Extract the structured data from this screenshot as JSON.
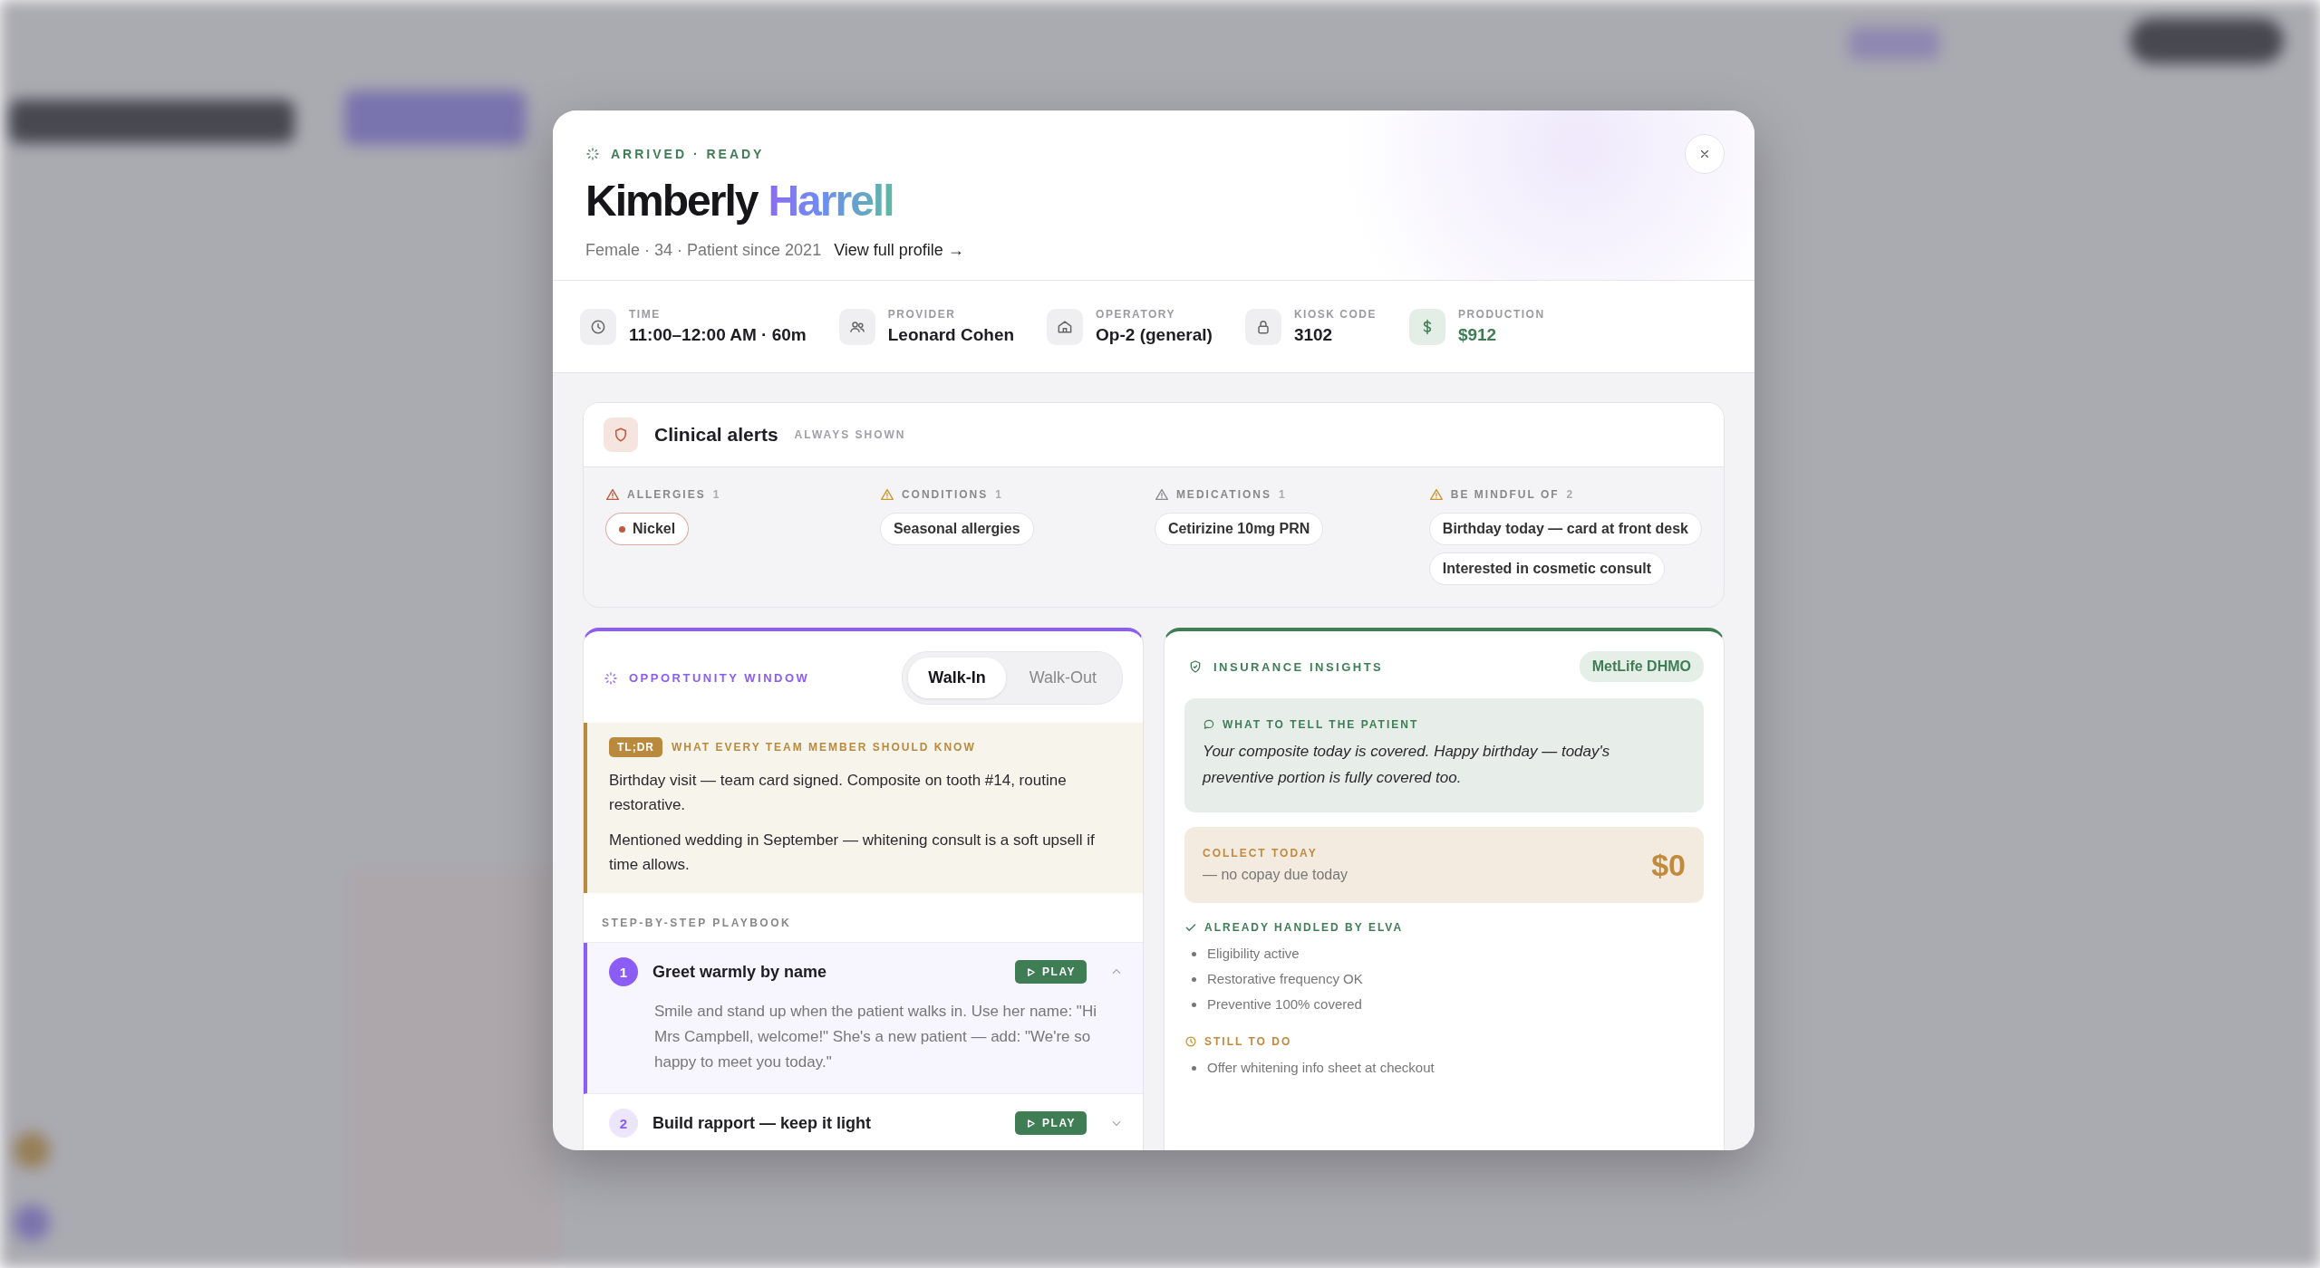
{
  "modal": {
    "status": "ARRIVED · READY",
    "patient": {
      "first_name": "Kimberly",
      "last_name": "Harrell",
      "summary": "Female · 34 · Patient since 2021",
      "profile_link": "View full profile →"
    },
    "facts": [
      {
        "kind": "time",
        "label": "TIME",
        "value": "11:00–12:00 AM · 60m"
      },
      {
        "kind": "provider",
        "label": "PROVIDER",
        "value": "Leonard Cohen"
      },
      {
        "kind": "operatory",
        "label": "OPERATORY",
        "value": "Op-2 (general)"
      },
      {
        "kind": "kiosk",
        "label": "KIOSK CODE",
        "value": "3102"
      },
      {
        "kind": "production",
        "label": "PRODUCTION",
        "value": "$912"
      }
    ],
    "clinical_alerts": {
      "title": "Clinical alerts",
      "note": "ALWAYS SHOWN",
      "groups": [
        {
          "kind": "allergy",
          "label": "ALLERGIES",
          "count": "1",
          "color": "#c0583f",
          "items": [
            "Nickel"
          ]
        },
        {
          "kind": "condition",
          "label": "CONDITIONS",
          "count": "1",
          "color": "#c9962f",
          "items": [
            "Seasonal allergies"
          ]
        },
        {
          "kind": "medication",
          "label": "MEDICATIONS",
          "count": "1",
          "color": "#8a8a8f",
          "items": [
            "Cetirizine 10mg PRN"
          ]
        },
        {
          "kind": "mindful",
          "label": "BE MINDFUL OF",
          "count": "2",
          "color": "#c9962f",
          "items": [
            "Birthday today — card at front desk",
            "Interested in cosmetic consult"
          ]
        }
      ]
    },
    "opportunity": {
      "title": "OPPORTUNITY WINDOW",
      "tabs": [
        {
          "label": "Walk-In",
          "selected": true
        },
        {
          "label": "Walk-Out",
          "selected": false
        }
      ],
      "tldr": {
        "badge": "TL;DR",
        "heading": "WHAT EVERY TEAM MEMBER SHOULD KNOW",
        "paragraphs": [
          "Birthday visit — team card signed. Composite on tooth #14, routine restorative.",
          "Mentioned wedding in September — whitening consult is a soft upsell if time allows."
        ]
      },
      "playbook": {
        "title": "STEP-BY-STEP PLAYBOOK",
        "steps": [
          {
            "number": "1",
            "title": "Greet warmly by name",
            "play": "PLAY",
            "expanded": true,
            "body": "Smile and stand up when the patient walks in. Use her name: \"Hi Mrs Campbell, welcome!\" She's a new patient — add: \"We're so happy to meet you today.\""
          },
          {
            "number": "2",
            "title": "Build rapport — keep it light",
            "play": "PLAY",
            "expanded": false
          }
        ]
      }
    },
    "insurance": {
      "title": "INSURANCE INSIGHTS",
      "plan": "MetLife DHMO",
      "tell": {
        "heading": "WHAT TO TELL THE PATIENT",
        "text": "Your composite today is covered. Happy birthday — today's preventive portion is fully covered too."
      },
      "collect": {
        "label": "COLLECT TODAY",
        "note": "— no copay due today",
        "amount": "$0"
      },
      "handled": {
        "heading": "ALREADY HANDLED BY ELVA",
        "items": [
          "Eligibility active",
          "Restorative frequency OK",
          "Preventive 100% covered"
        ]
      },
      "todo": {
        "heading": "STILL TO DO",
        "items": [
          "Offer whitening info sheet at checkout"
        ]
      }
    }
  }
}
